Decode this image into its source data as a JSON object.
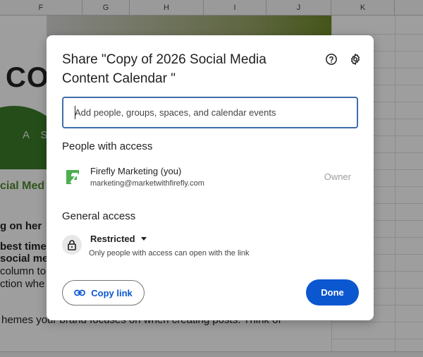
{
  "sheet": {
    "columns": [
      "F",
      "G",
      "H",
      "I",
      "J",
      "K"
    ],
    "big_text": "CO",
    "green_text": "A S",
    "heading": "cial Med",
    "lines": [
      {
        "text": "g on her",
        "bold": true
      },
      {
        "text": "best time",
        "bold": true
      },
      {
        "text": "social me",
        "bold": true
      },
      {
        "text": "column to",
        "bold": false
      },
      {
        "text": "ction whe",
        "bold": false
      },
      {
        "text": "hemes your brand focuses on when creating posts. Think of",
        "bold": false
      }
    ]
  },
  "dialog": {
    "title": "Share \"Copy of 2026 Social Media Content Calendar \"",
    "help_icon": "help-circle-icon",
    "settings_icon": "gear-icon",
    "search": {
      "placeholder": "Add people, groups, spaces, and calendar events",
      "value": ""
    },
    "people_section_title": "People with access",
    "people": [
      {
        "name": "Firefly Marketing (you)",
        "email": "marketing@marketwithfirefly.com",
        "role": "Owner",
        "logo_color": "#4caf50"
      }
    ],
    "general_section_title": "General access",
    "general": {
      "value": "Restricted",
      "description": "Only people with access can open with the link",
      "icon": "lock-icon"
    },
    "copy_link_label": "Copy link",
    "done_label": "Done",
    "accent_color": "#0b57d0"
  }
}
